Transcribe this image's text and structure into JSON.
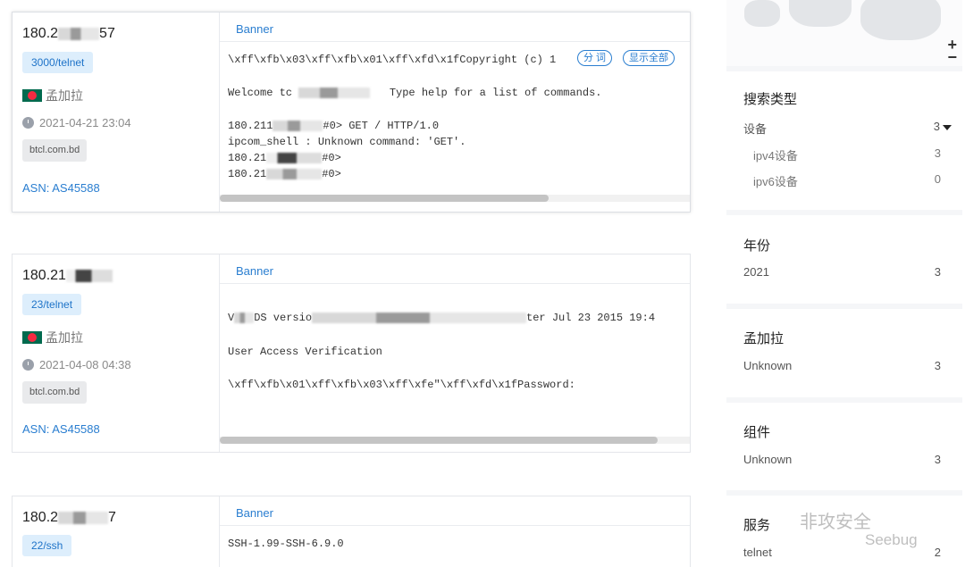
{
  "results": [
    {
      "ip_prefix": "180.2",
      "ip_suffix": "57",
      "port": "3000/telnet",
      "country": "孟加拉",
      "time": "2021-04-21 23:04",
      "domain": "btcl.com.bd",
      "asn_label": "ASN:",
      "asn": "AS45588",
      "banner_title": "Banner",
      "banner_lines": [
        "\\xff\\xfb\\x03\\xff\\xfb\\x01\\xff\\xfd\\x1fCopyright (c) 1",
        "",
        "Welcome tc",
        "Type help for a list of commands.",
        "180.211",
        "#0> GET / HTTP/1.0",
        "ipcom_shell : Unknown command: 'GET'.",
        "180.21",
        "#0>",
        "180.21",
        "#0>"
      ],
      "pill_segment": "分 词",
      "pill_show_all": "显示全部"
    },
    {
      "ip_prefix": "180.21",
      "ip_suffix": "",
      "port": "23/telnet",
      "country": "孟加拉",
      "time": "2021-04-08 04:38",
      "domain": "btcl.com.bd",
      "asn_label": "ASN:",
      "asn": "AS45588",
      "banner_title": "Banner",
      "banner_lines": [
        "V",
        "DS versio",
        "ter Jul 23 2015 19:4",
        "User Access Verification",
        "\\xff\\xfb\\x01\\xff\\xfb\\x03\\xff\\xfe\"\\xff\\xfd\\x1fPassword:"
      ]
    },
    {
      "ip_prefix": "180.2",
      "ip_suffix": "7",
      "port": "22/ssh",
      "banner_title": "Banner",
      "banner_lines": [
        "SSH-1.99-SSH-6.9.0"
      ]
    }
  ],
  "sidebar": {
    "zoom_in": "+",
    "zoom_out": "−",
    "search_type": {
      "title": "搜索类型",
      "rows": [
        {
          "label": "设备",
          "value": "3"
        },
        {
          "label": "ipv4设备",
          "value": "3"
        },
        {
          "label": "ipv6设备",
          "value": "0"
        }
      ]
    },
    "year": {
      "title": "年份",
      "rows": [
        {
          "label": "2021",
          "value": "3"
        }
      ]
    },
    "country": {
      "title": "孟加拉",
      "rows": [
        {
          "label": "Unknown",
          "value": "3"
        }
      ]
    },
    "component": {
      "title": "组件",
      "rows": [
        {
          "label": "Unknown",
          "value": "3"
        }
      ]
    },
    "service": {
      "title": "服务",
      "rows": [
        {
          "label": "telnet",
          "value": "2"
        }
      ]
    }
  },
  "watermark": {
    "line1": "非攻安全",
    "line2": "Seebug"
  }
}
